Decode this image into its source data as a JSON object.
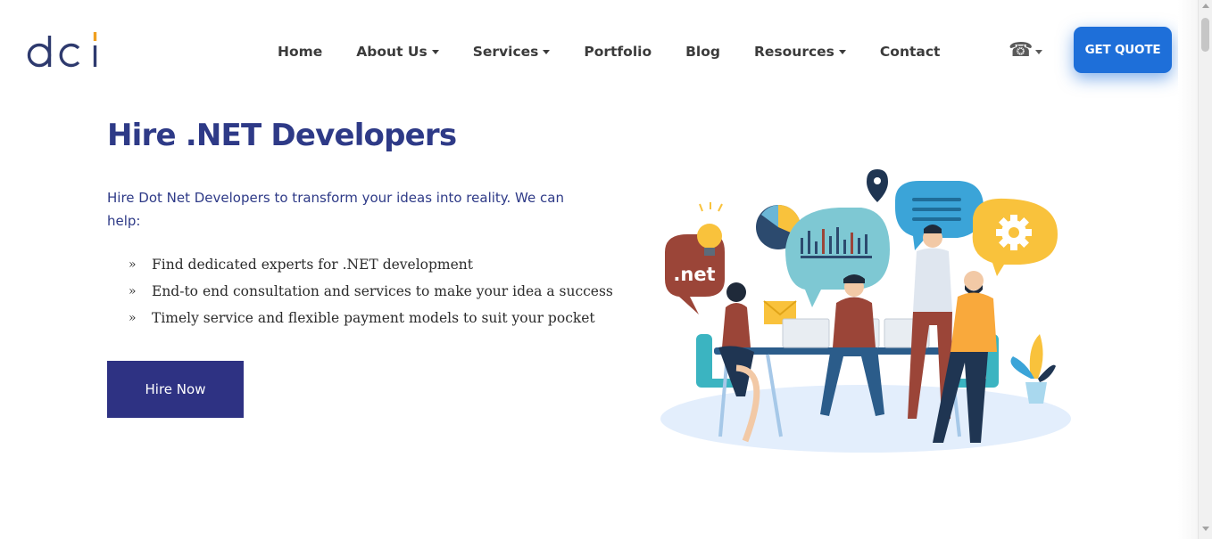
{
  "header": {
    "logo_text": "dci",
    "nav": [
      {
        "label": "Home",
        "has_dropdown": false
      },
      {
        "label": "About Us",
        "has_dropdown": true
      },
      {
        "label": "Services",
        "has_dropdown": true
      },
      {
        "label": "Portfolio",
        "has_dropdown": false
      },
      {
        "label": "Blog",
        "has_dropdown": false
      },
      {
        "label": "Resources",
        "has_dropdown": true
      },
      {
        "label": "Contact",
        "has_dropdown": false
      }
    ],
    "phone_icon": "phone-icon",
    "quote_button": "GET QUOTE"
  },
  "hero": {
    "title": "Hire .NET Developers",
    "intro": "Hire Dot Net Developers to transform your ideas into reality. We can help:",
    "bullet_symbol": "»",
    "features": [
      "Find dedicated experts for .NET development",
      "End-to end consultation and services to make your idea a success",
      "Timely service and flexible payment models to suit your pocket"
    ],
    "cta": "Hire Now",
    "illustration_label": ".net"
  },
  "colors": {
    "primary_dark": "#2e3a87",
    "button_dark": "#2e3283",
    "accent_blue": "#1e6fd9",
    "logo_orange": "#f0a020"
  }
}
